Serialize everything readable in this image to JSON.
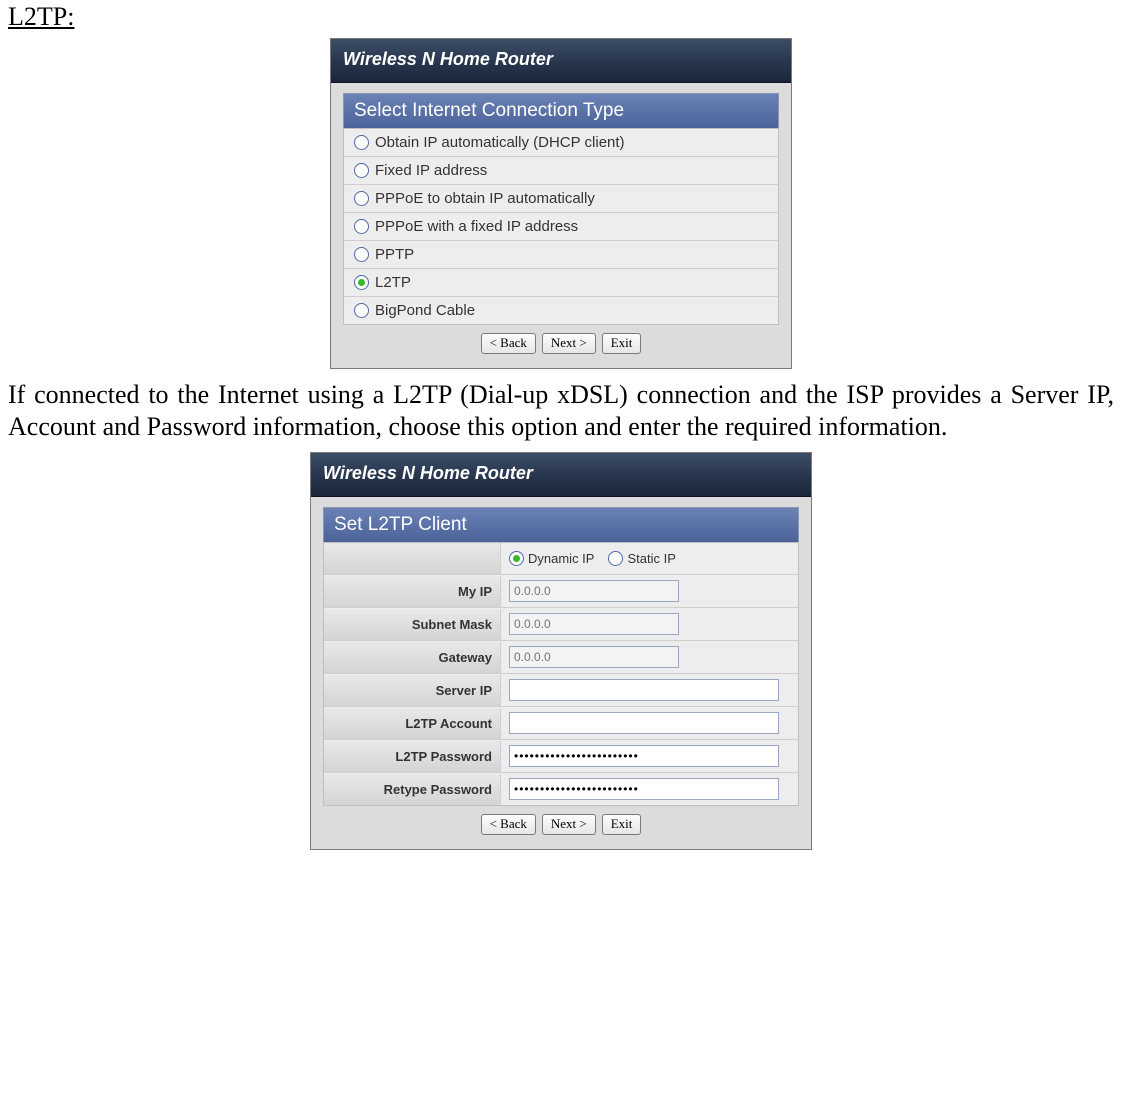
{
  "heading": "L2TP:",
  "paragraph": "If connected to the Internet using a L2TP (Dial-up xDSL) connection and the ISP provides a Server IP, Account and Password information, choose this option and enter the required information.",
  "panelA": {
    "title": "Wireless N Home Router",
    "header": "Select Internet Connection Type",
    "options": [
      {
        "label": "Obtain IP automatically (DHCP client)",
        "selected": false
      },
      {
        "label": "Fixed IP address",
        "selected": false
      },
      {
        "label": "PPPoE to obtain IP automatically",
        "selected": false
      },
      {
        "label": "PPPoE with a fixed IP address",
        "selected": false
      },
      {
        "label": "PPTP",
        "selected": false
      },
      {
        "label": "L2TP",
        "selected": true
      },
      {
        "label": "BigPond Cable",
        "selected": false
      }
    ],
    "buttons": {
      "back": "< Back",
      "next": "Next >",
      "exit": "Exit"
    }
  },
  "panelB": {
    "title": "Wireless N Home Router",
    "header": "Set L2TP Client",
    "ipmode": {
      "dynamic": {
        "label": "Dynamic IP",
        "selected": true
      },
      "static": {
        "label": "Static IP",
        "selected": false
      }
    },
    "fields": {
      "myip": {
        "label": "My IP",
        "placeholder": "0.0.0.0",
        "value": "",
        "disabled": true,
        "wide": false
      },
      "subnet": {
        "label": "Subnet Mask",
        "placeholder": "0.0.0.0",
        "value": "",
        "disabled": true,
        "wide": false
      },
      "gateway": {
        "label": "Gateway",
        "placeholder": "0.0.0.0",
        "value": "",
        "disabled": true,
        "wide": false
      },
      "server": {
        "label": "Server IP",
        "placeholder": "",
        "value": "",
        "disabled": false,
        "wide": true
      },
      "account": {
        "label": "L2TP Account",
        "placeholder": "",
        "value": "",
        "disabled": false,
        "wide": true
      },
      "pw": {
        "label": "L2TP Password",
        "placeholder": "",
        "value": "••••••••••••••••••••••••",
        "disabled": false,
        "wide": true
      },
      "rpw": {
        "label": "Retype Password",
        "placeholder": "",
        "value": "••••••••••••••••••••••••",
        "disabled": false,
        "wide": true
      }
    },
    "buttons": {
      "back": "< Back",
      "next": "Next >",
      "exit": "Exit"
    }
  }
}
